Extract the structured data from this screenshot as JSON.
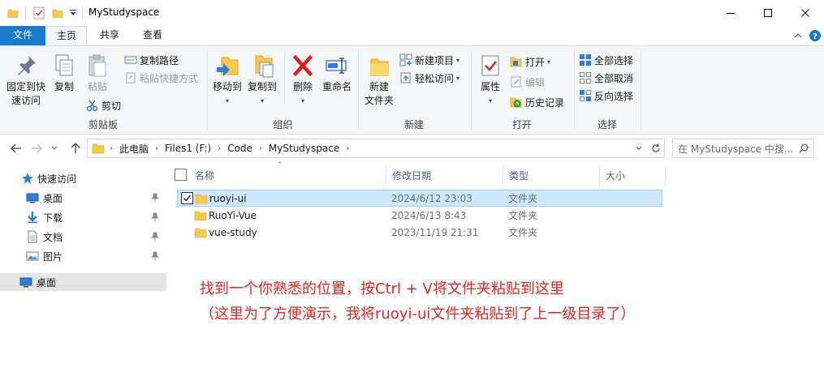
{
  "window": {
    "title": "MyStudyspace",
    "minimize_symbol": "—",
    "close_symbol": "✕"
  },
  "tabs": {
    "file": "文件",
    "home": "主页",
    "share": "共享",
    "view": "查看"
  },
  "ribbon": {
    "clipboard": {
      "label": "剪贴板",
      "pin_quick_access": "固定到快\n速访问",
      "copy": "复制",
      "paste": "粘贴",
      "copy_path": "复制路径",
      "paste_shortcut": "粘贴快捷方式",
      "cut": "剪切"
    },
    "organize": {
      "label": "组织",
      "move_to": "移动到",
      "copy_to": "复制到",
      "delete": "删除",
      "rename": "重命名"
    },
    "new": {
      "label": "新建",
      "new_folder": "新建\n文件夹",
      "new_item": "新建项目",
      "easy_access": "轻松访问"
    },
    "open": {
      "label": "打开",
      "properties": "属性",
      "open": "打开",
      "edit": "编辑",
      "history": "历史记录"
    },
    "select": {
      "label": "选择",
      "select_all": "全部选择",
      "select_none": "全部取消",
      "invert": "反向选择"
    }
  },
  "address": {
    "breadcrumbs": [
      "此电脑",
      "Files1 (F:)",
      "Code",
      "MyStudyspace"
    ],
    "search_placeholder": "在 MyStudyspace 中搜..."
  },
  "navpane": {
    "quick_access": "快速访问",
    "items": [
      {
        "label": "桌面",
        "icon": "desktop-icon",
        "pinned": true
      },
      {
        "label": "下载",
        "icon": "download-icon",
        "pinned": true
      },
      {
        "label": "文档",
        "icon": "document-icon",
        "pinned": true
      },
      {
        "label": "图片",
        "icon": "picture-icon",
        "pinned": true
      }
    ],
    "desktop": "桌面"
  },
  "filelist": {
    "columns": {
      "name": "名称",
      "modified": "修改日期",
      "type": "类型",
      "size": "大小"
    },
    "rows": [
      {
        "name": "ruoyi-ui",
        "modified": "2024/6/12 23:03",
        "type": "文件夹",
        "size": "",
        "selected": true
      },
      {
        "name": "RuoYi-Vue",
        "modified": "2024/6/13 8:43",
        "type": "文件夹",
        "size": "",
        "selected": false
      },
      {
        "name": "vue-study",
        "modified": "2023/11/19 21:31",
        "type": "文件夹",
        "size": "",
        "selected": false
      }
    ]
  },
  "annotation": {
    "line1": "找到一个你熟悉的位置，按Ctrl + V将文件夹粘贴到这里",
    "line2": "（这里为了方便演示，我将ruoyi-ui文件夹粘贴到了上一级目录了）",
    "color": "#e8231f"
  },
  "colors": {
    "accent": "#1979ca",
    "selection": "#cce8ff",
    "folder": "#f8c94c",
    "ribbon_bg": "#f5f6f7"
  }
}
